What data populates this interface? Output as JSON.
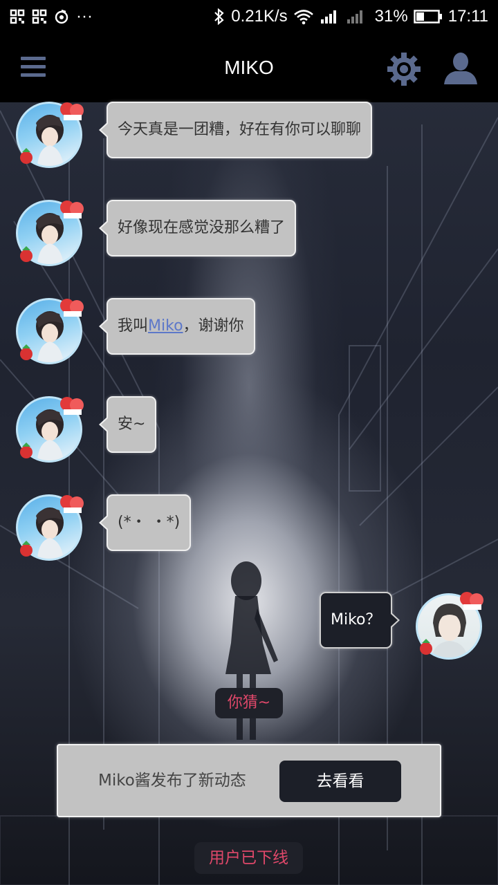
{
  "status_bar": {
    "net_speed": "0.21K/s",
    "battery": "31%",
    "time": "17:11",
    "overflow": "···"
  },
  "header": {
    "title": "MIKO",
    "menu_icon": "hamburger-icon",
    "settings_icon": "gear-icon",
    "profile_icon": "user-icon",
    "icon_color": "#5b6a8e"
  },
  "messages": [
    {
      "side": "left",
      "text": "今天真是一团糟，好在有你可以聊聊"
    },
    {
      "side": "left",
      "text": "好像现在感觉没那么糟了"
    },
    {
      "side": "left",
      "text_before": "我叫",
      "link": "Miko",
      "text_after": "，谢谢你"
    },
    {
      "side": "left",
      "text": "安~"
    },
    {
      "side": "left",
      "text": "(*・ ・*)"
    },
    {
      "side": "right",
      "text": "Miko？"
    }
  ],
  "hint": {
    "text": "你猜~",
    "color": "#e0486a"
  },
  "notice": {
    "text": "Miko酱发布了新动态",
    "button": "去看看"
  },
  "offline_status": {
    "text": "用户已下线"
  }
}
